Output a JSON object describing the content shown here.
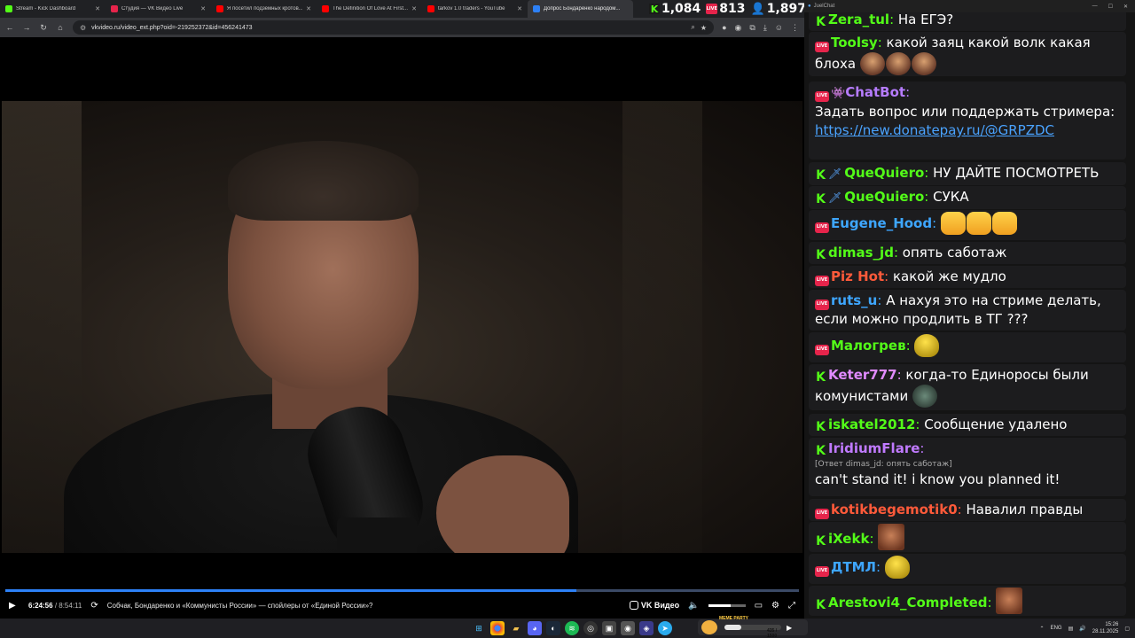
{
  "tabs": [
    {
      "label": "Stream - Kick Dashboard",
      "color": "#53fc18",
      "active": false
    },
    {
      "label": "Студия — VK Видео Live",
      "color": "#e6244b",
      "active": false
    },
    {
      "label": "Я посетил подземных кротов...",
      "color": "#ff0000",
      "active": false
    },
    {
      "label": "The Definition Of Love At First...",
      "color": "#ff0000",
      "active": false
    },
    {
      "label": "tarkov 1.0 traders - YouTube",
      "color": "#ff0000",
      "active": false
    },
    {
      "label": "Допрос Бондаренко народом...",
      "color": "#2d81f7",
      "active": true
    }
  ],
  "stats": {
    "kick_viewers": "1,084",
    "vk_viewers": "813",
    "total_viewers": "1,897"
  },
  "address": {
    "url": "vkvideo.ru/video_ext.php?oid=-219252372&id=456241473"
  },
  "player": {
    "current_time": "6:24:56",
    "duration": "/ 8:54:11",
    "title": "Собчак, Бондаренко и «Коммунисты России» — спойлеры от «Единой России»?",
    "brand": "VK Видео",
    "progress": 0.72,
    "volume": 0.6
  },
  "chat_window": {
    "title": "JuelChat"
  },
  "chat": [
    {
      "platform": "kick",
      "nick": "Zera_tul",
      "color": "#53fc18",
      "text": "На ЕГЭ?"
    },
    {
      "platform": "vk",
      "nick": "Toolsy",
      "color": "#53fc18",
      "text": "какой заяц какой волк какая блоха"
    },
    {
      "platform": "vk",
      "nick": "ChatBot",
      "color": "#b67cff",
      "text": "Задать вопрос или поддержать стримера:",
      "link": "https://new.donatepay.ru/@GRPZDC"
    },
    {
      "platform": "kick",
      "nick": "QueQuiero",
      "color": "#53fc18",
      "text": "НУ ДАЙТЕ ПОСМОТРЕТЬ"
    },
    {
      "platform": "kick",
      "nick": "QueQuiero",
      "color": "#53fc18",
      "text": "СУКА"
    },
    {
      "platform": "vk",
      "nick": "Eugene_Hood",
      "color": "#3ea6ff",
      "text": ""
    },
    {
      "platform": "kick",
      "nick": "dimas_jd",
      "color": "#53fc18",
      "text": "опять саботаж"
    },
    {
      "platform": "vk",
      "nick": "Piz Hot",
      "color": "#ff5a3a",
      "text": "какой же мудло"
    },
    {
      "platform": "vk",
      "nick": "ruts_u",
      "color": "#3ea6ff",
      "text": "А нахуя это на стриме делать, если можно продлить в ТГ ???"
    },
    {
      "platform": "vk",
      "nick": "Малогрев",
      "color": "#53fc18",
      "text": ""
    },
    {
      "platform": "kick",
      "nick": "Keter777",
      "color": "#e08aff",
      "text": "когда-то Единоросы были комунистами"
    },
    {
      "platform": "kick",
      "nick": "iskatel2012",
      "color": "#53fc18",
      "text": "Сообщение удалено"
    },
    {
      "platform": "kick",
      "nick": "IridiumFlare",
      "color": "#c07aff",
      "reply": "[Ответ dimas_jd: опять саботаж]",
      "text": "can't stand it! i know you planned it!"
    },
    {
      "platform": "vk",
      "nick": "kotikbegemotik0",
      "color": "#ff5a3a",
      "text": "Навалил правды"
    },
    {
      "platform": "kick",
      "nick": "iXekk",
      "color": "#53fc18",
      "text": ""
    },
    {
      "platform": "vk",
      "nick": "ДТМЛ",
      "color": "#3ea6ff",
      "text": ""
    },
    {
      "platform": "kick",
      "nick": "Arestovi4_Completed",
      "color": "#53fc18",
      "text": ""
    }
  ],
  "taskbar": {
    "meme_label": "MEME PARTY",
    "meme_value": "435 / 1500",
    "meme_progress": 0.29,
    "lang": "ENG",
    "time": "15:26",
    "date": "28.11.2025"
  }
}
